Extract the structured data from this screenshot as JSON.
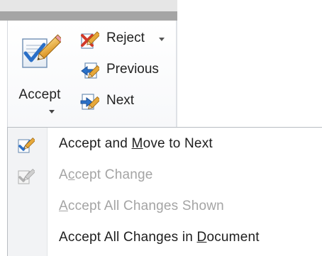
{
  "ribbon": {
    "accept_label": "Accept",
    "reject_label": "Reject",
    "previous_label": "Previous",
    "next_label": "Next"
  },
  "accept_menu": {
    "items": [
      {
        "pre": "Accept and ",
        "key": "M",
        "post": "ove to Next",
        "enabled": true,
        "icon": "accept-check-icon"
      },
      {
        "pre": "A",
        "key": "c",
        "post": "cept Change",
        "enabled": false,
        "icon": "accept-check-icon"
      },
      {
        "pre": "",
        "key": "A",
        "post": "ccept All Changes Shown",
        "enabled": false,
        "icon": "none"
      },
      {
        "pre": "Accept All Changes in ",
        "key": "D",
        "post": "ocument",
        "enabled": true,
        "icon": "none"
      }
    ]
  }
}
